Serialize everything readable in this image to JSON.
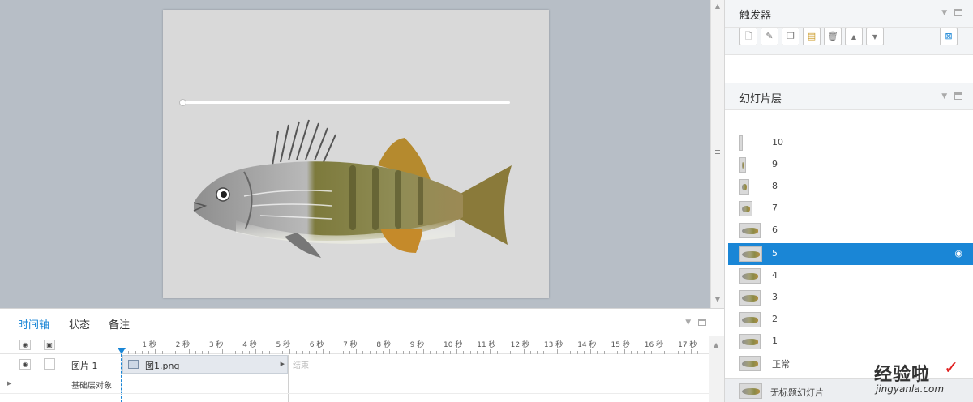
{
  "triggers_panel": {
    "title": "触发器"
  },
  "layers_panel": {
    "title": "幻灯片层",
    "layers": [
      {
        "label": "10",
        "selected": false
      },
      {
        "label": "9",
        "selected": false
      },
      {
        "label": "8",
        "selected": false
      },
      {
        "label": "7",
        "selected": false
      },
      {
        "label": "6",
        "selected": false
      },
      {
        "label": "5",
        "selected": true
      },
      {
        "label": "4",
        "selected": false
      },
      {
        "label": "3",
        "selected": false
      },
      {
        "label": "2",
        "selected": false
      },
      {
        "label": "1",
        "selected": false
      },
      {
        "label": "正常",
        "selected": false
      }
    ],
    "base_layer_label": "无标题幻灯片"
  },
  "timeline": {
    "tabs": [
      "时间轴",
      "状态",
      "备注"
    ],
    "active_tab": "时间轴",
    "ruler_labels": [
      "1 秒",
      "2 秒",
      "3 秒",
      "4 秒",
      "5 秒",
      "6 秒",
      "7 秒",
      "8 秒",
      "9 秒",
      "10 秒",
      "11 秒",
      "12 秒",
      "13 秒",
      "14 秒",
      "15 秒",
      "16 秒",
      "17 秒"
    ],
    "rows": {
      "object_name": "图片 1",
      "base_layer_objects": "基础层对象"
    },
    "clip": {
      "label": "图1.png",
      "end_label": "结束"
    }
  },
  "icons": {
    "eye": "eye-icon",
    "lock": "lock-icon",
    "new": "new-trigger-icon",
    "edit": "edit-icon",
    "copy": "copy-icon",
    "paste": "paste-icon",
    "delete": "delete-icon",
    "up": "move-up-icon",
    "down": "move-down-icon",
    "variables": "variables-icon"
  },
  "colors": {
    "accent": "#1a86d6",
    "canvas_bg": "#b7bec6",
    "slide_bg": "#d9d9d9"
  },
  "watermark": {
    "brand": "经验啦",
    "url": "jingyanla.com"
  }
}
